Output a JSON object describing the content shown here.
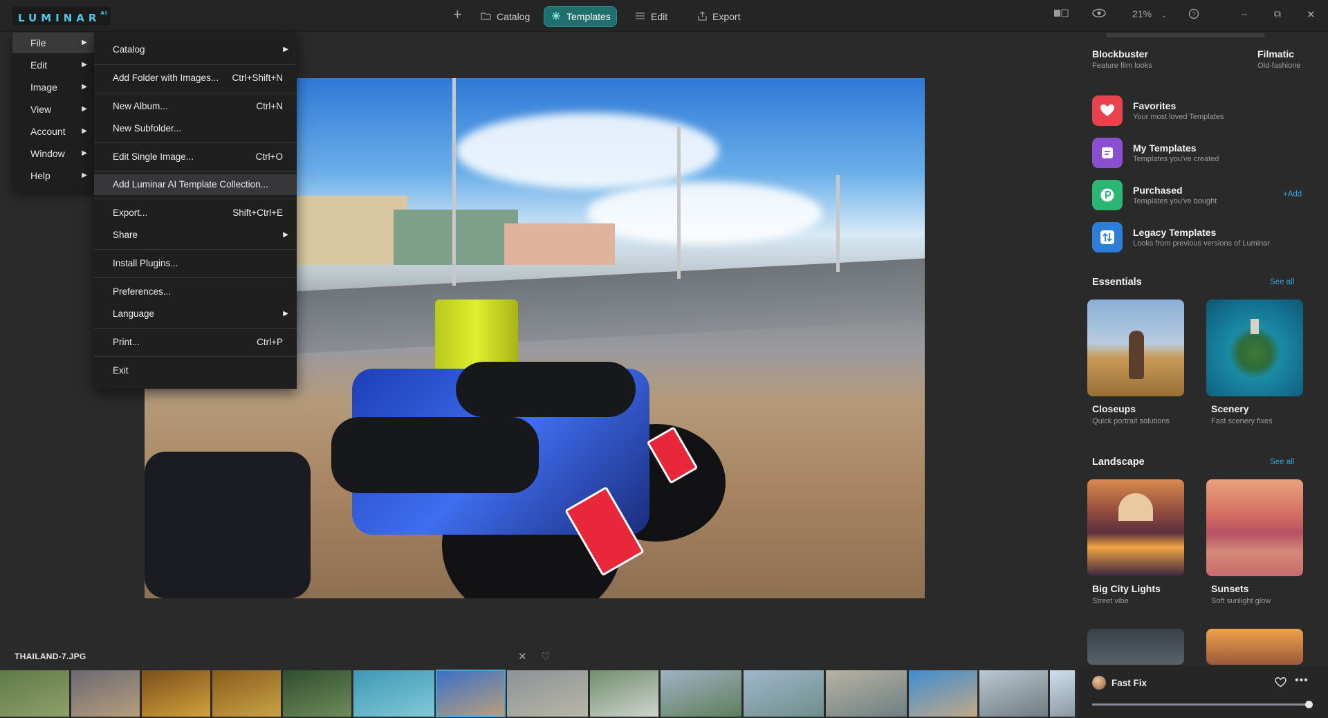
{
  "app": {
    "logo": "LUMINAR",
    "logo_suffix": "AI"
  },
  "nav": {
    "catalog": "Catalog",
    "templates": "Templates",
    "edit": "Edit",
    "export": "Export"
  },
  "topright": {
    "zoom": "21%"
  },
  "menu_bar": [
    "File",
    "Edit",
    "Image",
    "View",
    "Account",
    "Window",
    "Help"
  ],
  "file_menu": [
    {
      "label": "Catalog",
      "shortcut": "",
      "submenu": true
    },
    {
      "label": "Add Folder with Images...",
      "shortcut": "Ctrl+Shift+N",
      "submenu": false
    },
    {
      "label": "New Album...",
      "shortcut": "Ctrl+N",
      "submenu": false
    },
    {
      "label": "New Subfolder...",
      "shortcut": "",
      "submenu": false
    },
    {
      "label": "Edit Single Image...",
      "shortcut": "Ctrl+O",
      "submenu": false
    },
    {
      "label": "Add Luminar AI Template Collection...",
      "shortcut": "",
      "submenu": false
    },
    {
      "label": "Export...",
      "shortcut": "Shift+Ctrl+E",
      "submenu": false
    },
    {
      "label": "Share",
      "shortcut": "",
      "submenu": true
    },
    {
      "label": "Install Plugins...",
      "shortcut": "",
      "submenu": false
    },
    {
      "label": "Preferences...",
      "shortcut": "",
      "submenu": false
    },
    {
      "label": "Language",
      "shortcut": "",
      "submenu": true
    },
    {
      "label": "Print...",
      "shortcut": "Ctrl+P",
      "submenu": false
    },
    {
      "label": "Exit",
      "shortcut": "",
      "submenu": false
    }
  ],
  "right_panel": {
    "top_templates": [
      {
        "title": "Blockbuster",
        "sub": "Feature film looks"
      },
      {
        "title": "Filmatic",
        "sub": "Old-fashione"
      }
    ],
    "collections": [
      {
        "title": "Favorites",
        "sub": "Your most loved Templates",
        "color": "#e8424f",
        "icon": "heart-icon"
      },
      {
        "title": "My Templates",
        "sub": "Templates you've created",
        "color": "#8a4fd1",
        "icon": "template-list-icon"
      },
      {
        "title": "Purchased",
        "sub": "Templates you've bought",
        "color": "#2bb673",
        "icon": "purchased-icon"
      },
      {
        "title": "Legacy Templates",
        "sub": "Looks from previous versions of Luminar",
        "color": "#2b7fd8",
        "icon": "legacy-arrows-icon"
      }
    ],
    "add_link": "+Add",
    "essentials": {
      "heading": "Essentials",
      "see_all": "See all",
      "items": [
        {
          "title": "Closeups",
          "sub": "Quick portrait solutions"
        },
        {
          "title": "Scenery",
          "sub": "Fast scenery fixes"
        }
      ]
    },
    "landscape": {
      "heading": "Landscape",
      "see_all": "See all",
      "items": [
        {
          "title": "Big City Lights",
          "sub": "Street vibe"
        },
        {
          "title": "Sunsets",
          "sub": "Soft sunlight glow"
        }
      ]
    },
    "fast_fix": {
      "label": "Fast Fix",
      "amount": 1.0
    }
  },
  "filmstrip": {
    "filename": "THAILAND-7.JPG",
    "thumbs": [
      {
        "c1": "#5e7a48",
        "c2": "#8fa06a",
        "w": 100
      },
      {
        "c1": "#6a6a72",
        "c2": "#b79d7c",
        "w": 99
      },
      {
        "c1": "#7a4e1c",
        "c2": "#d2a13a",
        "w": 99
      },
      {
        "c1": "#8a5b1e",
        "c2": "#c9a344",
        "w": 99
      },
      {
        "c1": "#2f4e2e",
        "c2": "#6e8b5b",
        "w": 99
      },
      {
        "c1": "#3f98b6",
        "c2": "#7fc9d6",
        "w": 117
      },
      {
        "c1": "#3a6fc9",
        "c2": "#b9a07a",
        "w": 99,
        "selected": true
      },
      {
        "c1": "#8c9296",
        "c2": "#b8b6a8",
        "w": 117
      },
      {
        "c1": "#6f8f6a",
        "c2": "#cfd3cf",
        "w": 99
      },
      {
        "c1": "#9fb3c6",
        "c2": "#5e7e5a",
        "w": 117
      },
      {
        "c1": "#9fb7cc",
        "c2": "#6f8e8a",
        "w": 116
      },
      {
        "c1": "#b8b2a3",
        "c2": "#6e7f82",
        "w": 117
      },
      {
        "c1": "#3f8cd0",
        "c2": "#c2a989",
        "w": 99
      },
      {
        "c1": "#bcc8d2",
        "c2": "#6f7b80",
        "w": 99
      },
      {
        "c1": "#cfe0ee",
        "c2": "#8a98a2",
        "w": 36
      }
    ]
  }
}
